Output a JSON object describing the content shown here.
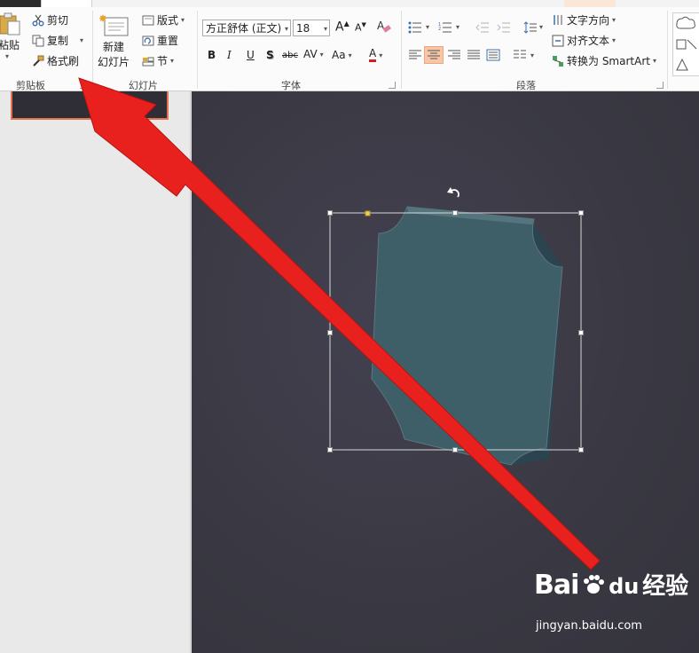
{
  "colors": {
    "accent": "#e1734d",
    "arrow": "#e8211f",
    "shape": "#3e5e66",
    "slide_bg": "#3a3943"
  },
  "ribbon": {
    "clipboard": {
      "paste": "粘贴",
      "cut": "剪切",
      "copy": "复制",
      "format_painter": "格式刷",
      "group": "剪贴板"
    },
    "slides": {
      "new_slide_line1": "新建",
      "new_slide_line2": "幻灯片",
      "layout": "版式",
      "reset": "重置",
      "section": "节",
      "group": "幻灯片"
    },
    "font": {
      "font_name": "方正舒体 (正文)",
      "font_size": "18",
      "group": "字体",
      "bold": "B",
      "italic": "I",
      "underline": "U",
      "shadow": "S",
      "strike": "abc",
      "spacing": "AV",
      "case": "Aa",
      "color": "A"
    },
    "paragraph": {
      "text_direction": "文字方向",
      "align_text": "对齐文本",
      "smartart": "转换为 SmartArt",
      "group": "段落"
    }
  },
  "watermark": {
    "brand": "Bai",
    "brand2": "du",
    "product": "经验",
    "url": "jingyan.baidu.com"
  }
}
